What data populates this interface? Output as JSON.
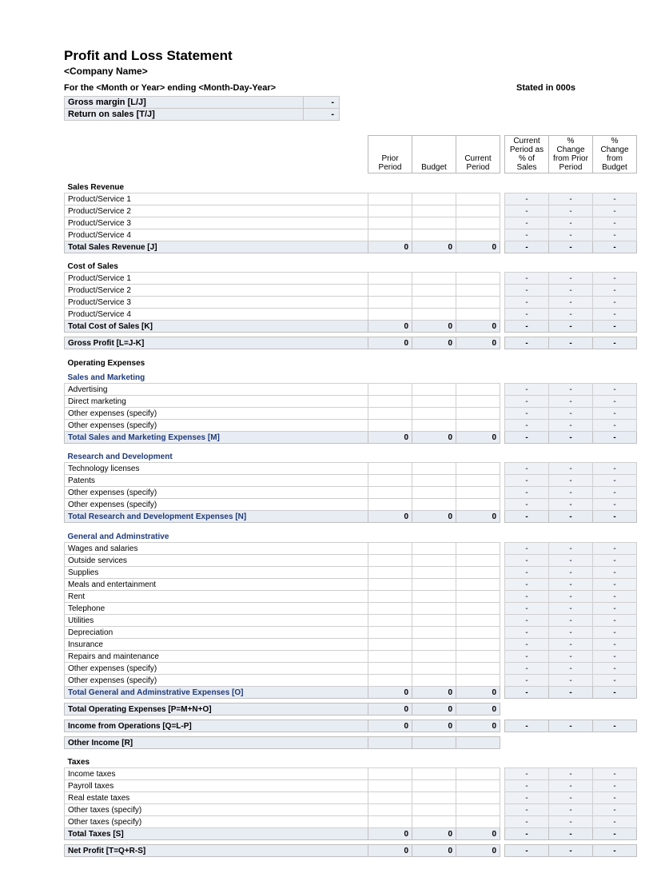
{
  "title": "Profit and Loss Statement",
  "company": "<Company Name>",
  "period_line": "For the <Month or Year> ending <Month-Day-Year>",
  "stated_in": "Stated in 000s",
  "metrics": {
    "gross_margin_label": "Gross margin  [L/J]",
    "gross_margin_val": "-",
    "return_on_sales_label": "Return on sales  [T/J]",
    "return_on_sales_val": "-"
  },
  "columns": {
    "prior": "Prior Period",
    "budget": "Budget",
    "current": "Current Period",
    "pct_sales": "Current Period as % of Sales",
    "pct_prior": "% Change from Prior Period",
    "pct_budget": "% Change from Budget"
  },
  "dash": "-",
  "zero": "0",
  "sections": {
    "sales_revenue": {
      "title": "Sales Revenue",
      "rows": [
        "Product/Service 1",
        "Product/Service 2",
        "Product/Service 3",
        "Product/Service 4"
      ],
      "total": "Total Sales Revenue  [J]"
    },
    "cost_of_sales": {
      "title": "Cost of Sales",
      "rows": [
        "Product/Service 1",
        "Product/Service 2",
        "Product/Service 3",
        "Product/Service 4"
      ],
      "total": "Total Cost of Sales  [K]"
    },
    "gross_profit": "Gross Profit  [L=J-K]",
    "operating_expenses": "Operating Expenses",
    "sales_marketing": {
      "title": "Sales and Marketing",
      "rows": [
        "Advertising",
        "Direct marketing",
        "Other expenses (specify)",
        "Other expenses (specify)"
      ],
      "total": "Total Sales and Marketing Expenses  [M]"
    },
    "rnd": {
      "title": "Research and Development",
      "rows": [
        "Technology licenses",
        "Patents",
        "Other expenses (specify)",
        "Other expenses (specify)"
      ],
      "total": "Total Research and Development Expenses  [N]"
    },
    "ga": {
      "title": "General and Adminstrative",
      "rows": [
        "Wages and salaries",
        "Outside services",
        "Supplies",
        "Meals and entertainment",
        "Rent",
        "Telephone",
        "Utilities",
        "Depreciation",
        "Insurance",
        "Repairs and maintenance",
        "Other expenses (specify)",
        "Other expenses (specify)"
      ],
      "total": "Total General and Adminstrative Expenses  [O]"
    },
    "total_opex": "Total Operating Expenses  [P=M+N+O]",
    "income_ops": "Income from Operations  [Q=L-P]",
    "other_income": "Other Income  [R]",
    "taxes": {
      "title": "Taxes",
      "rows": [
        "Income taxes",
        "Payroll taxes",
        "Real estate taxes",
        "Other taxes (specify)",
        "Other taxes (specify)"
      ],
      "total": "Total Taxes  [S]"
    },
    "net_profit": "Net Profit  [T=Q+R-S]"
  }
}
